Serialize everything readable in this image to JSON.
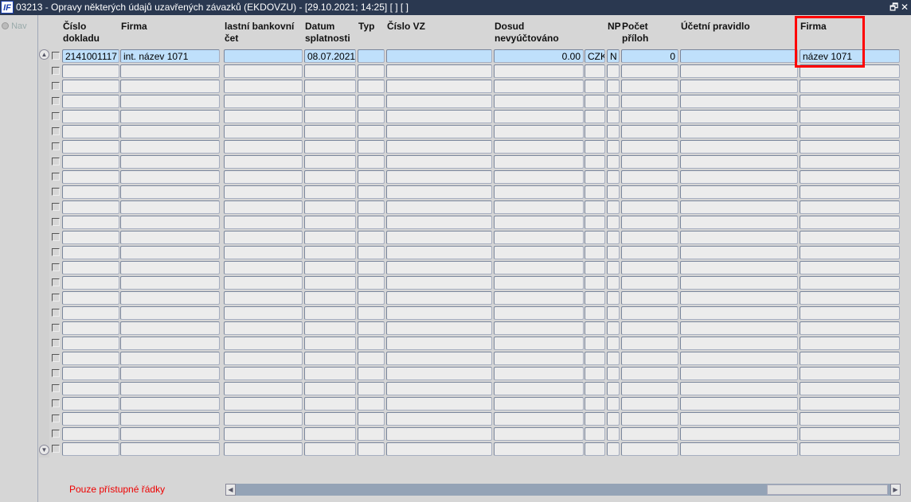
{
  "window": {
    "title": "03213 - Opravy některých údajů uzavřených závazků (EKDOVZU) - [29.10.2021; 14:25]  [ ]  [ ]",
    "logo": "IF",
    "restore_icon": "restore-icon",
    "close_icon": "close-icon"
  },
  "nav": {
    "label": "Nav"
  },
  "columns": [
    {
      "key": "cislo",
      "l1": "Číslo",
      "l2": "dokladu"
    },
    {
      "key": "firma",
      "l1": "Firma",
      "l2": ""
    },
    {
      "key": "bank",
      "l1": "lastní bankovní",
      "l2": "čet"
    },
    {
      "key": "datum",
      "l1": "Datum",
      "l2": "splatnosti"
    },
    {
      "key": "typ",
      "l1": "Typ",
      "l2": ""
    },
    {
      "key": "vz",
      "l1": "Číslo VZ",
      "l2": ""
    },
    {
      "key": "dosud",
      "l1": "Dosud",
      "l2": "nevyúčtováno"
    },
    {
      "key": "mena",
      "l1": "",
      "l2": ""
    },
    {
      "key": "np",
      "l1": "NP",
      "l2": ""
    },
    {
      "key": "pocet",
      "l1": "Počet",
      "l2": "příloh"
    },
    {
      "key": "pravidlo",
      "l1": "Účetní pravidlo",
      "l2": ""
    },
    {
      "key": "firma2",
      "l1": "Firma",
      "l2": ""
    }
  ],
  "rows": [
    {
      "cislo": "2141001117",
      "firma": "int. název 1071",
      "bank": "",
      "datum": "08.07.2021",
      "typ": "",
      "vz": "",
      "dosud": "0.00",
      "mena": "CZK",
      "np": "N",
      "pocet": "0",
      "pravidlo": "",
      "firma2": "název 1071"
    }
  ],
  "status": {
    "text": "Pouze přístupné řádky",
    "color": "#ff0000"
  },
  "colors": {
    "selected_row": "#bfe0fb",
    "titlebar": "#2a3850",
    "highlight": "#ff0000"
  }
}
